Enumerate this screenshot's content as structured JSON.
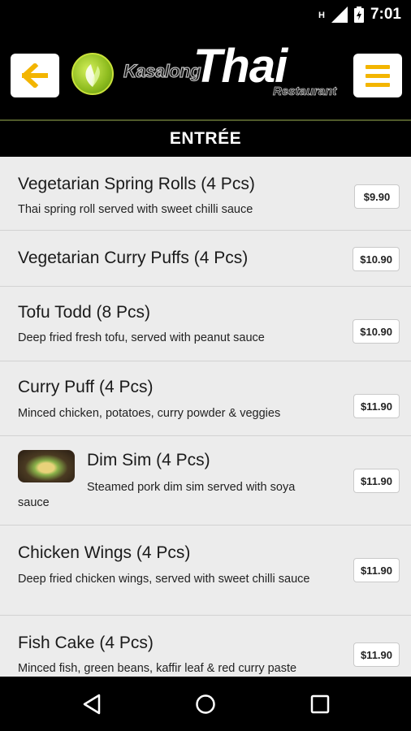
{
  "status_bar": {
    "time": "7:01",
    "icons": [
      "network-type-icon",
      "signal-icon",
      "battery-icon"
    ]
  },
  "header": {
    "back_icon": "arrow-left-icon",
    "menu_icon": "hamburger-menu-icon",
    "logo": {
      "small_text": "Kasalong",
      "big_text": "Thai",
      "sub_text": "Restaurant"
    },
    "accent_color": "#f3b500"
  },
  "section": {
    "title": "ENTRÉE"
  },
  "items": [
    {
      "name": "Vegetarian Spring Rolls (4 Pcs)",
      "description": "Thai spring roll served with sweet chilli sauce",
      "price": "$9.90"
    },
    {
      "name": "Vegetarian Curry Puffs (4 Pcs)",
      "description": "",
      "price": "$10.90"
    },
    {
      "name": "Tofu Todd (8 Pcs)",
      "description": "Deep fried fresh tofu, served with peanut sauce",
      "price": "$10.90"
    },
    {
      "name": "Curry Puff (4 Pcs)",
      "description": "Minced chicken, potatoes, curry powder & veggies",
      "price": "$11.90"
    },
    {
      "name": "Dim Sim (4 Pcs)",
      "description_line1": "Steamed pork dim sim served with soya",
      "description_line2": "sauce",
      "price": "$11.90"
    },
    {
      "name": "Chicken Wings (4 Pcs)",
      "description": "Deep fried chicken wings, served with sweet chilli sauce",
      "price": "$11.90"
    },
    {
      "name": "Fish Cake (4 Pcs)",
      "description": "Minced fish, green beans, kaffir leaf & red curry paste",
      "price": "$11.90"
    }
  ],
  "nav_bar": {
    "icons": [
      "back-triangle-icon",
      "home-circle-icon",
      "recents-square-icon"
    ]
  }
}
